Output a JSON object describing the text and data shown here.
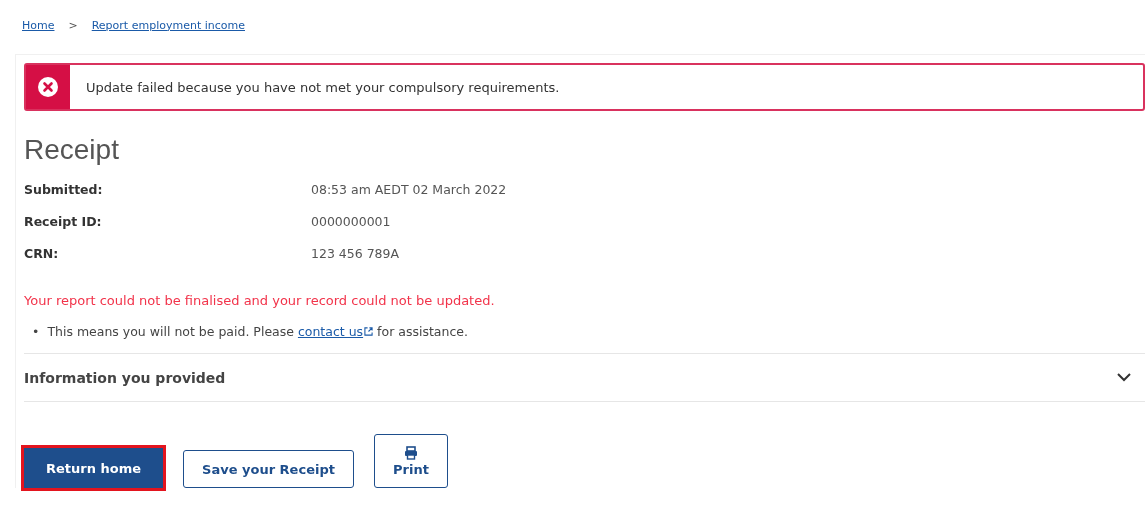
{
  "breadcrumb": [
    {
      "label": "Home"
    },
    {
      "label": "Report employment income"
    }
  ],
  "breadcrumb_separator": ">",
  "alert": {
    "kind": "error",
    "message": "Update failed because you have not met your compulsory requirements."
  },
  "title": "Receipt",
  "details": [
    {
      "label": "Submitted:",
      "value": "08:53 am AEDT 02 March 2022"
    },
    {
      "label": "Receipt ID:",
      "value": "0000000001"
    },
    {
      "label": "CRN:",
      "value": "123 456 789A"
    }
  ],
  "error_text": "Your report could not be finalised and your record could not be updated.",
  "bullets": [
    {
      "marker": "•",
      "before": "This means you will not be paid. Please ",
      "link": "contact us",
      "after": " for assistance."
    }
  ],
  "accordion": {
    "label": "Information you provided",
    "expanded": false
  },
  "buttons": [
    {
      "label": "Return home",
      "kind": "primary",
      "focused": true
    },
    {
      "label": "Save your Receipt",
      "kind": "secondary",
      "focused": false
    },
    {
      "label": "Print",
      "kind": "print",
      "focused": false
    }
  ]
}
